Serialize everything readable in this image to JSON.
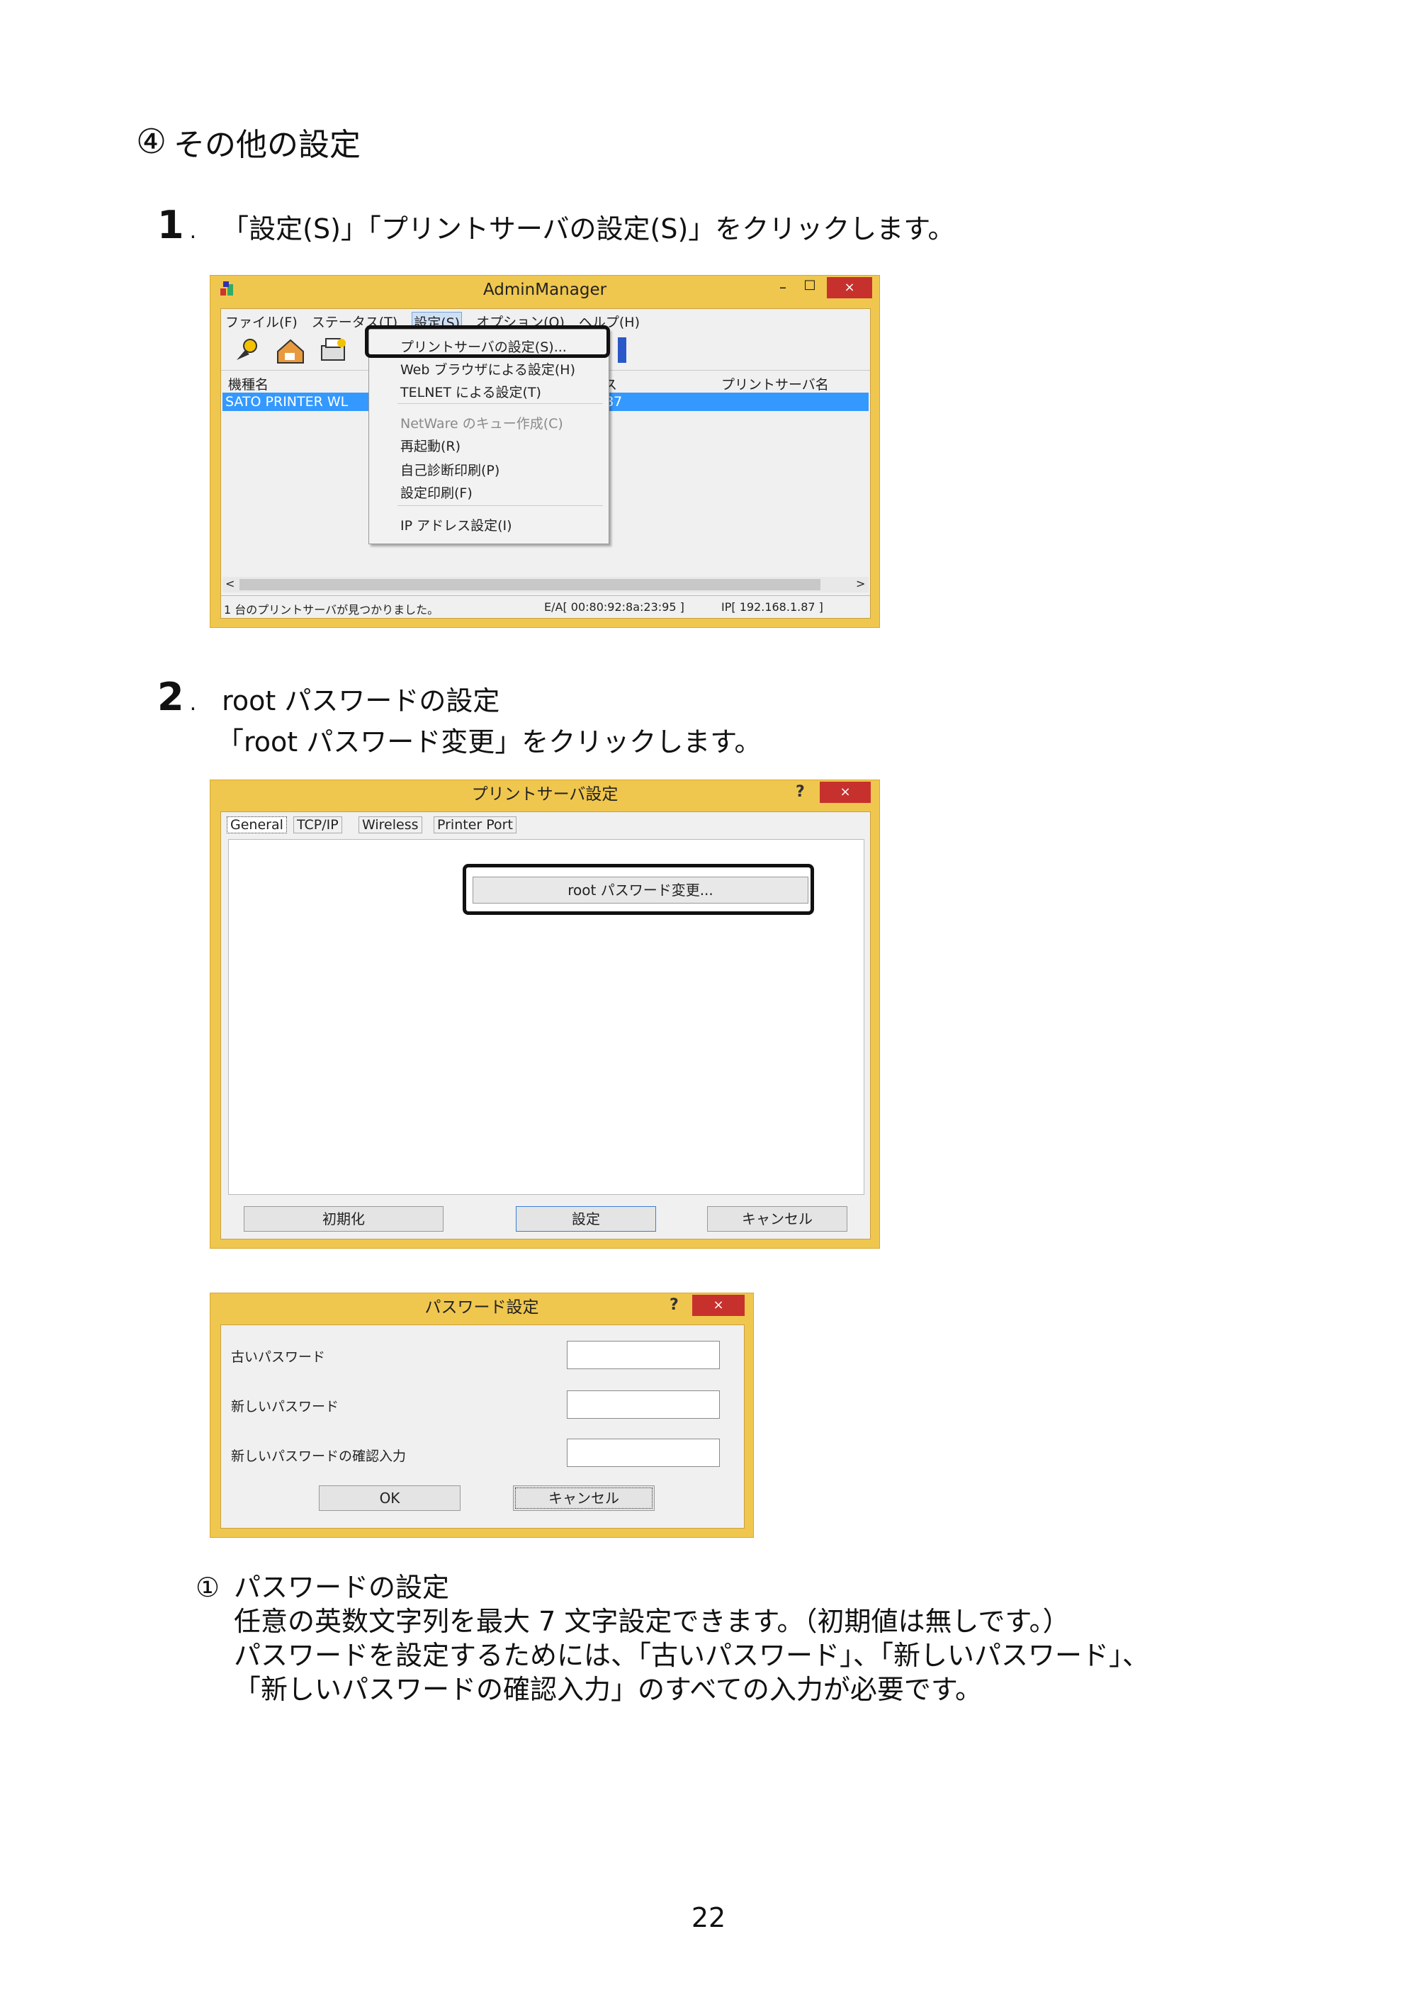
{
  "heading": {
    "marker": "④",
    "title": "その他の設定"
  },
  "step1": {
    "number": "1",
    "dot": ".",
    "text": "「設定(S)」「プリントサーバの設定(S)」をクリックします。"
  },
  "admin": {
    "title": "AdminManager",
    "controls": {
      "minimize": "–",
      "maximize": "□",
      "close": "×"
    },
    "menubar": [
      "ファイル(F)",
      "ステータス(T)",
      "設定(S)",
      "オプション(O)",
      "ヘルプ(H)"
    ],
    "columns": {
      "model": "機種名",
      "ip_partial": "ス",
      "server_name": "プリントサーバ名"
    },
    "row": {
      "model": "SATO PRINTER WL",
      "ip_partial": "87"
    },
    "menu_items": [
      "プリントサーバの設定(S)...",
      "Web ブラウザによる設定(H)",
      "TELNET による設定(T)",
      "NetWare のキュー作成(C)",
      "再起動(R)",
      "自己診断印刷(P)",
      "設定印刷(F)",
      "IP アドレス設定(I)"
    ],
    "status": {
      "found": "1 台のプリントサーバが見つかりました。",
      "ea": "E/A[ 00:80:92:8a:23:95 ]",
      "ip": "IP[ 192.168.1.87 ]"
    },
    "scroll": {
      "left": "<",
      "right": ">"
    }
  },
  "step2": {
    "number": "2",
    "dot": ".",
    "line1": "root パスワードの設定",
    "line2": "「root パスワード変更」をクリックします。"
  },
  "server_dialog": {
    "title": "プリントサーバ設定",
    "help": "?",
    "close": "×",
    "tabs": [
      "General",
      "TCP/IP",
      "Wireless",
      "Printer Port"
    ],
    "root_button": "root パスワード変更...",
    "buttons": {
      "init": "初期化",
      "set": "設定",
      "cancel": "キャンセル"
    }
  },
  "pw_dialog": {
    "title": "パスワード設定",
    "help": "?",
    "close": "×",
    "old_label": "古いパスワード",
    "new_label": "新しいパスワード",
    "confirm_label": "新しいパスワードの確認入力",
    "ok": "OK",
    "cancel": "キャンセル"
  },
  "note": {
    "marker": "①",
    "title": "パスワードの設定",
    "line1": "任意の英数文字列を最大 7 文字設定できます。（初期値は無しです。）",
    "line2": "パスワードを設定するためには、「古いパスワード」、「新しいパスワード」、",
    "line3": "「新しいパスワードの確認入力」のすべての入力が必要です。"
  },
  "page_number": "22"
}
